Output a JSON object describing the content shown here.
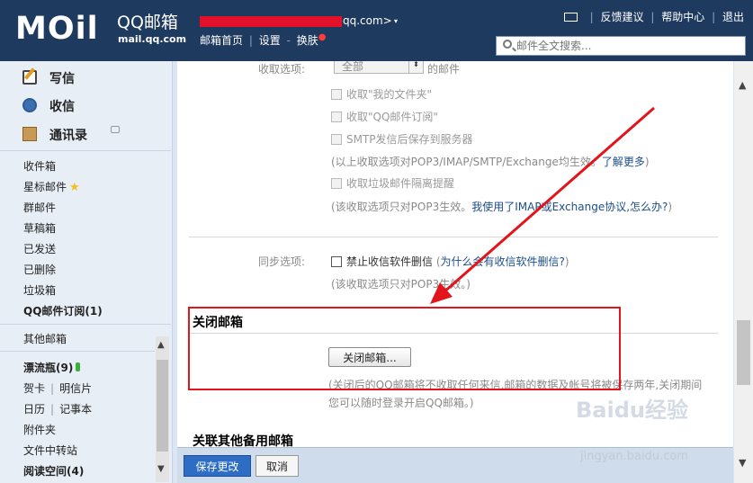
{
  "header": {
    "logo_text": "MOil",
    "brand_name": "QQ邮箱",
    "brand_url": "mail.qq.com",
    "account_suffix": "qq.com>",
    "account_caret": "▾",
    "nav": [
      "邮箱首页",
      "设置",
      "换肤"
    ],
    "nav_separator": "|",
    "nav_separator2": "-",
    "top_links": [
      "反馈建议",
      "帮助中心",
      "退出"
    ],
    "search_placeholder": "邮件全文搜索..."
  },
  "sidebar": {
    "compose": {
      "write": "写信",
      "inbox": "收信",
      "contacts": "通讯录"
    },
    "folders": [
      "收件箱",
      "星标邮件",
      "群邮件",
      "草稿箱",
      "已发送",
      "已删除",
      "垃圾箱",
      "QQ邮件订阅(1)"
    ],
    "other_mailbox": "其他邮箱",
    "drift_bottle": "漂流瓶(9)",
    "card": "贺卡",
    "postcard": "明信片",
    "calendar": "日历",
    "notepad": "记事本",
    "attachments": "附件夹",
    "file_transfer": "文件中转站",
    "reading_space": "阅读空间(4)",
    "scroll_up": "▲",
    "scroll_down": "▼"
  },
  "settings": {
    "receive_option_label": "收取选项:",
    "receive_option_select": "全部",
    "receive_option_suffix": "的邮件",
    "opt_my_folders": "收取\"我的文件夹\"",
    "opt_qq_subscription": "收取\"QQ邮件订阅\"",
    "opt_smtp_save": "SMTP发信后保存到服务器",
    "note_protocols": "(以上收取选项对POP3/IMAP/SMTP/Exchange均生效。",
    "learn_more": "了解更多",
    "note_close_paren": ")",
    "opt_spam_isolation": "收取垃圾邮件隔离提醒",
    "note_pop3_only": "(该收取选项只对POP3生效。",
    "imap_help_link": "我使用了IMAP或Exchange协议,怎么办?",
    "sync_label": "同步选项:",
    "opt_no_delete": "禁止收信软件删信",
    "why_delete_link": "为什么会有收信软件删信?",
    "sync_open_paren": "(",
    "sync_close_paren": ")",
    "note_sync_pop3": "(该收取选项只对POP3生效。)"
  },
  "close_mailbox": {
    "title": "关闭邮箱",
    "button": "关闭邮箱...",
    "note_line1": "(关闭后的QQ邮箱将不收取任何来信,邮箱的数据及帐号将被保存两年,关闭期间",
    "note_line2": "您可以随时登录开启QQ邮箱。)"
  },
  "linked_mailbox": {
    "title": "关联其他备用邮箱"
  },
  "footer": {
    "save": "保存更改",
    "cancel": "取消"
  },
  "watermark": {
    "brand": "Baidu经验",
    "url": "jingyan.baidu.com"
  },
  "colors": {
    "header_bg": "#1e3a5f",
    "highlight_box": "#e3141b",
    "annotation_arrow": "#e3141b",
    "save_button": "#2e6dc4"
  }
}
